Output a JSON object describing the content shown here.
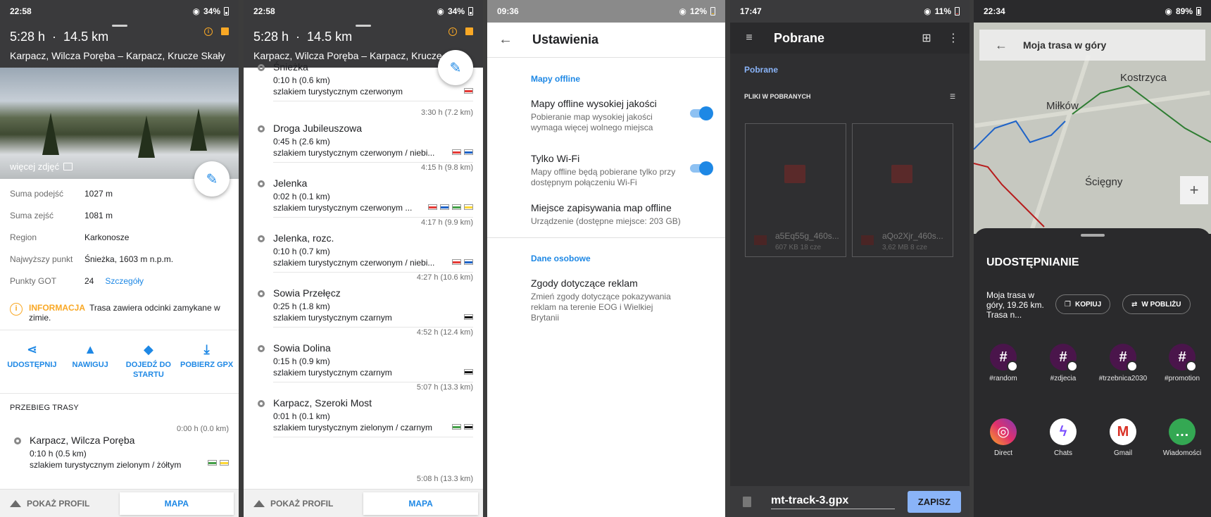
{
  "panel1": {
    "status": {
      "time": "22:58",
      "battery": "34%"
    },
    "header": {
      "duration": "5:28 h",
      "distance": "14.5 km",
      "route": "Karpacz, Wilcza Poręba – Karpacz, Krucze Skały"
    },
    "photo": {
      "more_photos": "więcej zdjęć"
    },
    "stats": [
      {
        "key": "Suma podejść",
        "value": "1027 m"
      },
      {
        "key": "Suma zejść",
        "value": "1081 m"
      },
      {
        "key": "Region",
        "value": "Karkonosze"
      },
      {
        "key": "Najwyższy punkt",
        "value": "Śnieżka, 1603 m n.p.m."
      },
      {
        "key": "Punkty GOT",
        "value": "24",
        "link": "Szczegóły"
      }
    ],
    "info": {
      "label": "INFORMACJA",
      "text": "Trasa zawiera odcinki zamykane w zimie."
    },
    "actions": [
      {
        "label": "UDOSTĘPNIJ",
        "icon": "share-icon"
      },
      {
        "label": "NAWIGUJ",
        "icon": "navigate-icon"
      },
      {
        "label": "DOJEDŹ DO STARTU",
        "icon": "directions-icon"
      },
      {
        "label": "POBIERZ GPX",
        "icon": "download-icon"
      }
    ],
    "section_title": "PRZEBIEG TRASY",
    "first_waypoint": {
      "time": "0:00 h (0.0 km)",
      "name": "Karpacz, Wilcza Poręba",
      "sub": "0:10 h (0.5 km)",
      "trail": "szlakiem turystycznym zielonym / żółtym"
    },
    "bottom": {
      "profile": "POKAŻ PROFIL",
      "map": "MAPA"
    }
  },
  "panel2": {
    "status": {
      "time": "22:58",
      "battery": "34%"
    },
    "header": {
      "duration": "5:28 h",
      "distance": "14.5 km",
      "route": "Karpacz, Wilcza Poręba – Karpacz, Krucze Sk"
    },
    "waypoints": [
      {
        "time": "",
        "name": "Śnieżka",
        "sub": "0:10 h (0.6 km)",
        "trail": "szlakiem turystycznym czerwonym",
        "flags": [
          "#e53935"
        ]
      },
      {
        "time": "3:30 h (7.2 km)",
        "name": "Droga Jubileuszowa",
        "sub": "0:45 h (2.6 km)",
        "trail": "szlakiem turystycznym czerwonym / niebi...",
        "flags": [
          "#e53935",
          "#1e63c8"
        ]
      },
      {
        "time": "4:15 h (9.8 km)",
        "name": "Jelenka",
        "sub": "0:02 h (0.1 km)",
        "trail": "szlakiem turystycznym czerwonym ...",
        "flags": [
          "#e53935",
          "#1e63c8",
          "#43a047",
          "#fdd835"
        ]
      },
      {
        "time": "4:17 h (9.9 km)",
        "name": "Jelenka, rozc.",
        "sub": "0:10 h (0.7 km)",
        "trail": "szlakiem turystycznym czerwonym / niebi...",
        "flags": [
          "#e53935",
          "#1e63c8"
        ]
      },
      {
        "time": "4:27 h (10.6 km)",
        "name": "Sowia Przełęcz",
        "sub": "0:25 h (1.8 km)",
        "trail": "szlakiem turystycznym czarnym",
        "flags": [
          "#111111"
        ]
      },
      {
        "time": "4:52 h (12.4 km)",
        "name": "Sowia Dolina",
        "sub": "0:15 h (0.9 km)",
        "trail": "szlakiem turystycznym czarnym",
        "flags": [
          "#111111"
        ]
      },
      {
        "time": "5:07 h (13.3 km)",
        "name": "Karpacz, Szeroki Most",
        "sub": "0:01 h (0.1 km)",
        "trail": "szlakiem turystycznym zielonym / czarnym",
        "flags": [
          "#43a047",
          "#111111"
        ]
      }
    ],
    "last_time": "5:08 h (13.3 km)",
    "bottom": {
      "profile": "POKAŻ PROFIL",
      "map": "MAPA"
    }
  },
  "panel3": {
    "status": {
      "time": "09:36",
      "battery": "12%"
    },
    "title": "Ustawienia",
    "sections": [
      {
        "header": "Mapy offline",
        "items": [
          {
            "title": "Mapy offline wysokiej jakości",
            "subtitle": "Pobieranie map wysokiej jakości wymaga więcej wolnego miejsca",
            "toggle": true
          },
          {
            "title": "Tylko Wi-Fi",
            "subtitle": "Mapy offline będą pobierane tylko przy dostępnym połączeniu Wi-Fi",
            "toggle": true
          },
          {
            "title": "Miejsce zapisywania map offline",
            "subtitle": "Urządzenie (dostępne miejsce: 203 GB)"
          }
        ]
      },
      {
        "header": "Dane osobowe",
        "items": [
          {
            "title": "Zgody dotyczące reklam",
            "subtitle": "Zmień zgody dotyczące pokazywania reklam na terenie EOG i Wielkiej Brytanii"
          }
        ]
      }
    ]
  },
  "panel4": {
    "status": {
      "time": "17:47",
      "battery": "11%"
    },
    "title": "Pobrane",
    "breadcrumb": "Pobrane",
    "section": "PLIKI W POBRANYCH",
    "files": [
      {
        "name": "a5Eq55g_460s...",
        "meta": "607 KB 18 cze"
      },
      {
        "name": "aQo2Xjr_460s...",
        "meta": "3,62 MB 8 cze"
      }
    ],
    "filename": "mt-track-3.gpx",
    "save": "ZAPISZ"
  },
  "panel5": {
    "status": {
      "time": "22:34",
      "battery": "89%"
    },
    "map": {
      "title": "Moja trasa w góry",
      "places": [
        "Kostrzyca",
        "Miłków",
        "Ścięgny"
      ],
      "zoom_in": "+"
    },
    "sheet": {
      "title": "UDOSTĘPNIANIE",
      "description": "Moja trasa w góry, 19.26 km. Trasa n...",
      "chips": [
        "KOPIUJ",
        "W POBLIŻU"
      ],
      "apps_row1": [
        "#random",
        "#zdjecia",
        "#trzebnica2030",
        "#promotion"
      ],
      "apps_row2": [
        "Direct",
        "Chats",
        "Gmail",
        "Wiadomości"
      ]
    }
  },
  "colors": {
    "accent": "#1e88e5",
    "warning": "#f9a825",
    "dark_header": "#3a3a3c"
  }
}
